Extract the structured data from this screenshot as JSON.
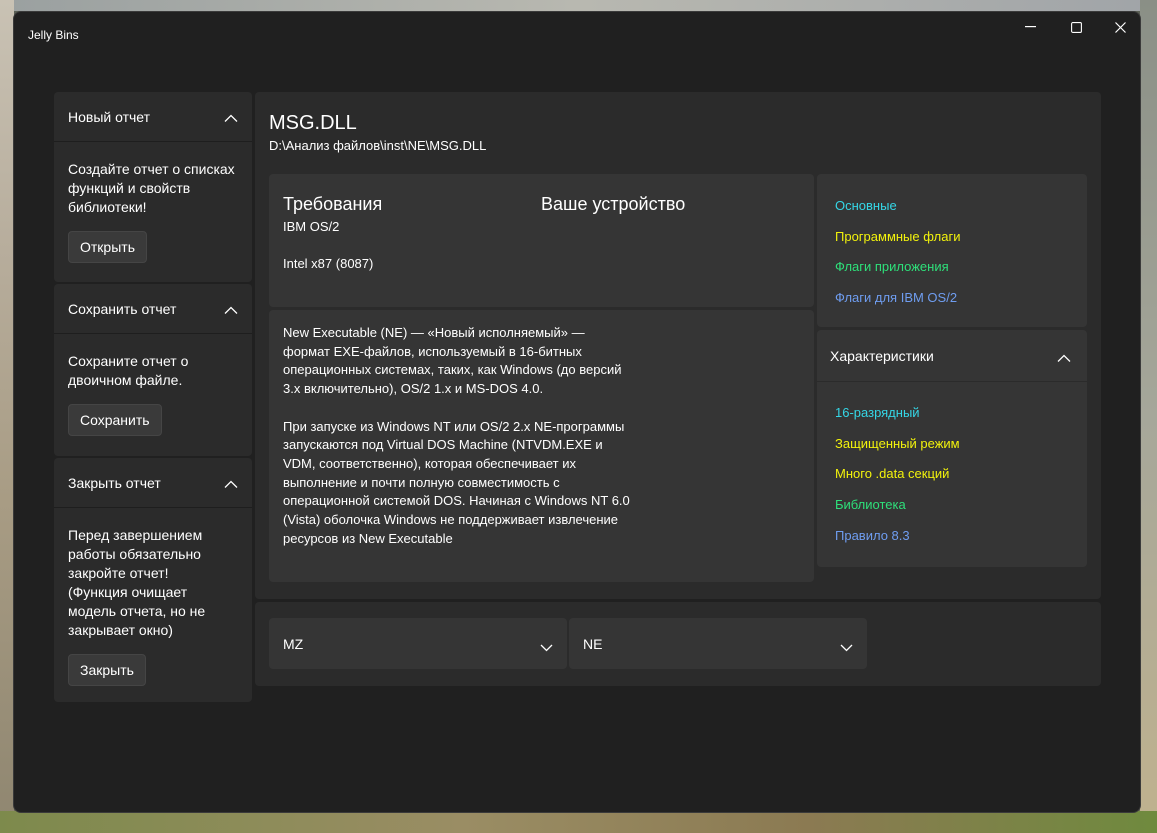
{
  "window": {
    "title": "Jelly Bins"
  },
  "sidebar": {
    "new_report": {
      "title": "Новый отчет",
      "text": "Создайте отчет о списках функций и свойств библиотеки!",
      "button": "Открыть"
    },
    "save_report": {
      "title": "Сохранить отчет",
      "text": "Сохраните отчет о двоичном файле.",
      "button": "Сохранить"
    },
    "close_report": {
      "title": "Закрыть отчет",
      "text": "Перед завершением работы обязательно закройте отчет! (Функция очищает модель отчета, но не закрывает окно)",
      "button": "Закрыть"
    }
  },
  "file": {
    "name": "MSG.DLL",
    "path": "D:\\Анализ файлов\\inst\\NE\\MSG.DLL"
  },
  "requirements": {
    "title": "Требования",
    "device_title": "Ваше устройство",
    "os": "IBM OS/2",
    "cpu": "Intel x87 (8087)"
  },
  "description": {
    "p1": "New Executable (NE) — «Новый исполняемый» — формат EXE-файлов, используемый в 16-битных операционных системах, таких, как Windows (до версий 3.x включительно), OS/2 1.x и MS-DOS 4.0.",
    "p2": "При запуске из Windows NT или OS/2 2.x NE-программы запускаются под Virtual DOS Machine (NTVDM.EXE и VDM, соответственно), которая обеспечивает их выполнение и почти полную совместимость с операционной системой DOS. Начиная с Windows NT 6.0 (Vista) оболочка Windows не поддерживает извлечение ресурсов из New Executable"
  },
  "flags": [
    {
      "label": "Основные",
      "color": "#35d6e6"
    },
    {
      "label": "Программные флаги",
      "color": "#f2f20c"
    },
    {
      "label": "Флаги приложения",
      "color": "#2ee07a"
    },
    {
      "label": "Флаги для IBM OS/2",
      "color": "#6f9df0"
    }
  ],
  "characteristics": {
    "title": "Характеристики",
    "items": [
      {
        "label": "16-разрядный",
        "color": "#35d6e6"
      },
      {
        "label": "Защищенный режим",
        "color": "#f2f20c"
      },
      {
        "label": "Много .data секций",
        "color": "#f2f20c"
      },
      {
        "label": "Библиотека",
        "color": "#2ee07a"
      },
      {
        "label": "Правило 8.3",
        "color": "#6f9df0"
      }
    ]
  },
  "selectors": {
    "mz": "MZ",
    "ne": "NE"
  }
}
